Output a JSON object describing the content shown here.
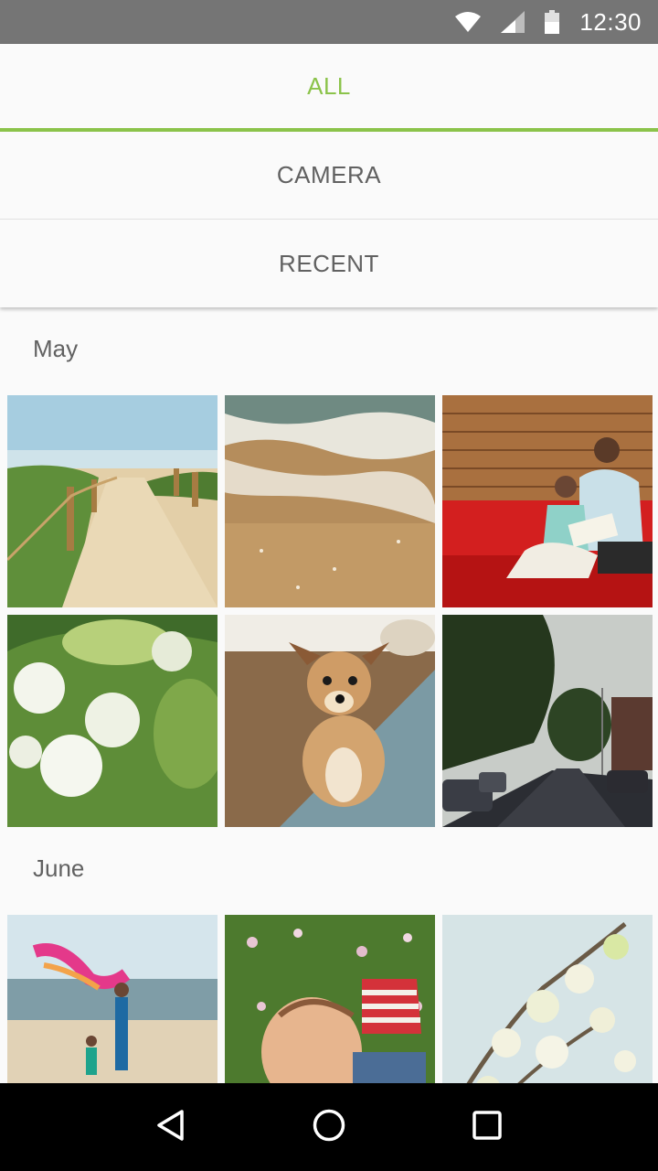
{
  "status_bar": {
    "time": "12:30",
    "icons": [
      "wifi-icon",
      "signal-icon",
      "battery-icon"
    ]
  },
  "tabs": [
    {
      "label": "ALL",
      "active": true
    },
    {
      "label": "CAMERA",
      "active": false
    },
    {
      "label": "RECENT",
      "active": false
    }
  ],
  "sections": [
    {
      "title": "May",
      "photos": [
        "beach-path",
        "ocean-waves",
        "mother-reading-child",
        "white-flowers",
        "dog",
        "street-dusk"
      ]
    },
    {
      "title": "June",
      "photos": [
        "beach-scarf",
        "child-in-flowers",
        "blossom-tree"
      ]
    }
  ],
  "nav_bar": {
    "buttons": [
      "back-icon",
      "home-icon",
      "recents-icon"
    ]
  },
  "colors": {
    "accent": "#8bc34a",
    "status_bar": "#757575",
    "background": "#fafafa",
    "tab_text": "#616161"
  }
}
